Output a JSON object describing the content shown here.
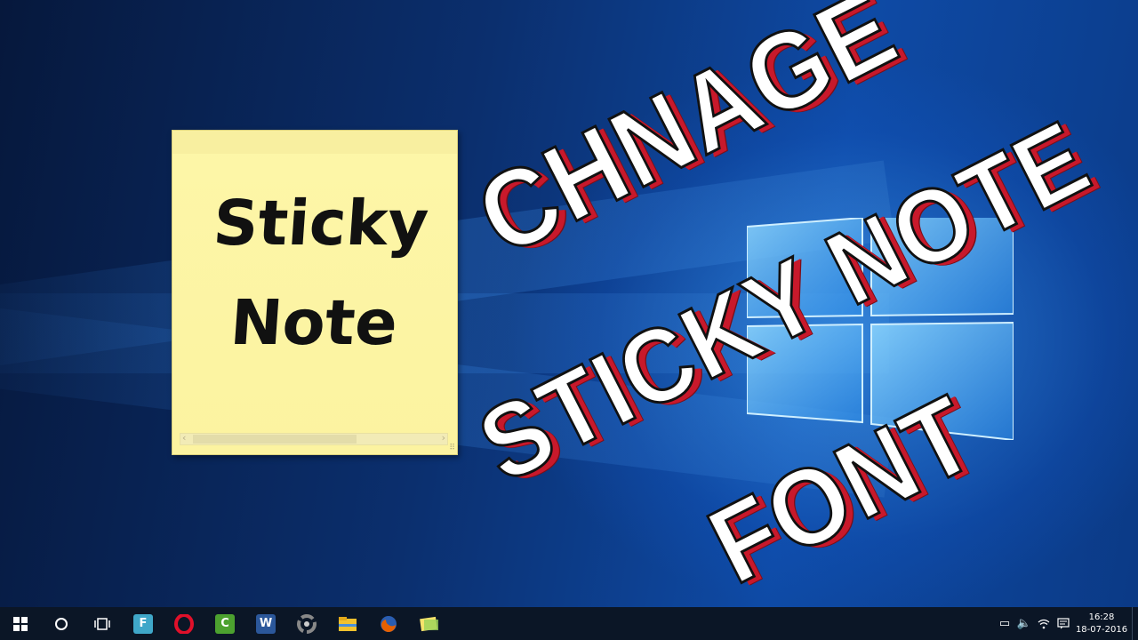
{
  "sticky_note": {
    "line1": "Sticky",
    "line2": "Note",
    "color": "#fdf6a8"
  },
  "overlay": {
    "line1": "CHNAGE",
    "line2": "STICKY NOTE",
    "line3": "FONT",
    "text_color": "#ffffff",
    "shadow_color": "#c8192b"
  },
  "taskbar": {
    "start_icon": "windows-logo-icon",
    "search_icon": "cortana-circle-icon",
    "task_view_icon": "task-view-icon",
    "apps": [
      {
        "name": "f-app",
        "label": "F",
        "color": "#3fa7c9"
      },
      {
        "name": "opera",
        "label": "O",
        "color": "#d0021b"
      },
      {
        "name": "camtasia",
        "label": "C",
        "color": "#4ca12f"
      },
      {
        "name": "word",
        "label": "W",
        "color": "#2b579a"
      },
      {
        "name": "chrome-like",
        "label": "",
        "color": "#555555"
      },
      {
        "name": "file-explorer",
        "label": "",
        "color": "#f2c12e"
      },
      {
        "name": "firefox",
        "label": "",
        "color": "#e66000"
      },
      {
        "name": "sticky-notes",
        "label": "",
        "color": "#f5e36b"
      }
    ],
    "tray": {
      "icons": [
        "battery-icon",
        "volume-icon",
        "wifi-icon",
        "action-center-icon"
      ],
      "time": "16:28",
      "date": "18-07-2016"
    }
  }
}
